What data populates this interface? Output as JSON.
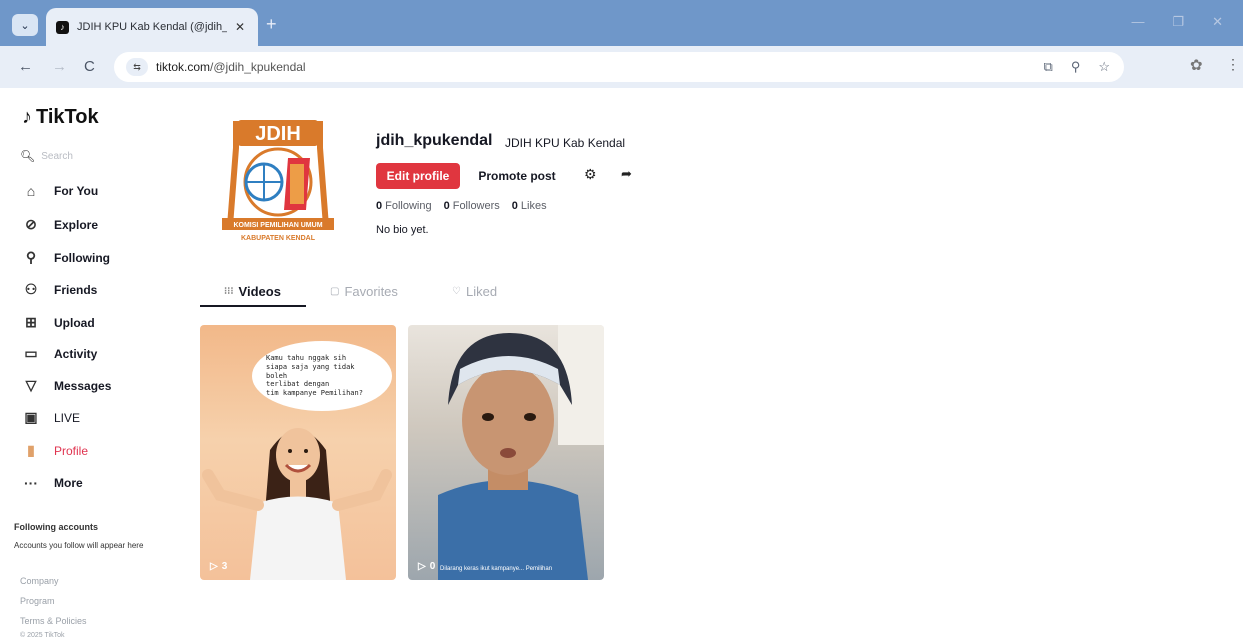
{
  "browser": {
    "tab_title": "JDIH KPU Kab Kendal (@jdih_k",
    "url_host": "tiktok.com",
    "url_path": "/@jdih_kpukendal"
  },
  "sidebar": {
    "logo": "TikTok",
    "search_placeholder": "Search",
    "items": [
      {
        "label": "For You",
        "icon": "home-icon"
      },
      {
        "label": "Explore",
        "icon": "compass-icon"
      },
      {
        "label": "Following",
        "icon": "user-plus-icon"
      },
      {
        "label": "Friends",
        "icon": "friends-icon"
      },
      {
        "label": "Upload",
        "icon": "upload-icon"
      },
      {
        "label": "Activity",
        "icon": "inbox-icon"
      },
      {
        "label": "Messages",
        "icon": "send-icon"
      },
      {
        "label": "LIVE",
        "icon": "live-tv-icon"
      },
      {
        "label": "Profile",
        "icon": "profile-icon"
      },
      {
        "label": "More",
        "icon": "more-icon"
      }
    ],
    "following_accounts_title": "Following accounts",
    "following_accounts_sub": "Accounts you follow will appear here",
    "footer": [
      "Company",
      "Program",
      "Terms & Policies",
      "© 2025 TikTok"
    ]
  },
  "profile": {
    "avatar_text": {
      "top": "JDIH",
      "ribbon": "KOMISI PEMILIHAN UMUM",
      "bottom": "KABUPATEN KENDAL"
    },
    "username": "jdih_kpukendal",
    "nickname": "JDIH KPU Kab Kendal",
    "edit_label": "Edit profile",
    "promote_label": "Promote post",
    "stats": [
      {
        "value": "0",
        "label": "Following"
      },
      {
        "value": "0",
        "label": "Followers"
      },
      {
        "value": "0",
        "label": "Likes"
      }
    ],
    "bio": "No bio yet."
  },
  "tabs": [
    {
      "label": "Videos",
      "active": true
    },
    {
      "label": "Favorites",
      "active": false
    },
    {
      "label": "Liked",
      "active": false
    }
  ],
  "videos": [
    {
      "views": "3",
      "bubble": "Kamu tahu nggak sih\nsiapa saja yang tidak boleh\nterlibat dengan\ntim kampanye Pemilihan?"
    },
    {
      "views": "0",
      "caption": "Dilarang keras ikut kampanye... Pemilihan"
    }
  ],
  "colors": {
    "accent": "#e0363f",
    "chrome": "#6f97c9",
    "profile_active": "#e03450"
  }
}
